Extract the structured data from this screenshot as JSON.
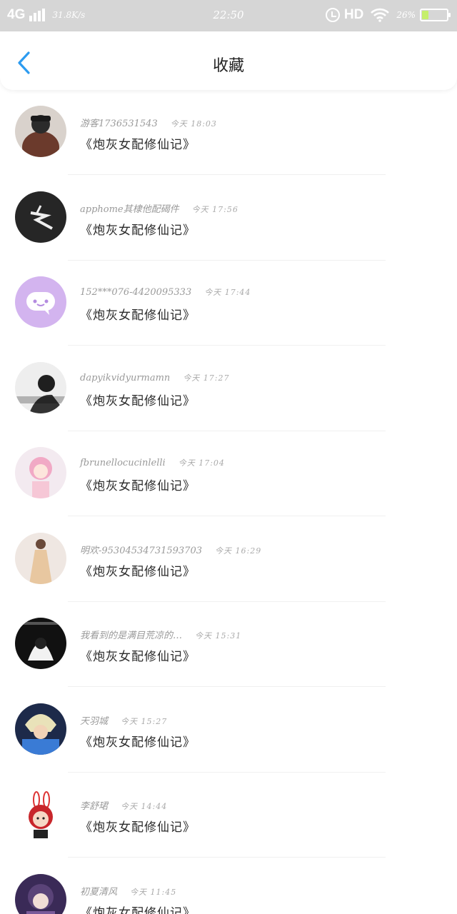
{
  "status_bar": {
    "network": "4G",
    "speed": "31.8K/s",
    "time": "22:50",
    "hd": "HD",
    "battery_pct": "26%",
    "battery_level": 0.26,
    "battery_color": "#c5ef6b"
  },
  "header": {
    "title": "收藏",
    "back_icon": "chevron-left-icon",
    "accent_color": "#2c9bf0"
  },
  "items": [
    {
      "user": "游客1736531543",
      "time": "今天 18:03",
      "title": "《炮灰女配修仙记》"
    },
    {
      "user": "apphome其棣他配碣件",
      "time": "今天 17:56",
      "title": "《炮灰女配修仙记》"
    },
    {
      "user": "152***076-4420095333",
      "time": "今天 17:44",
      "title": "《炮灰女配修仙记》"
    },
    {
      "user": "dapyikvidyurmamn",
      "time": "今天 17:27",
      "title": "《炮灰女配修仙记》"
    },
    {
      "user": "fbrunellocucinlelli",
      "time": "今天 17:04",
      "title": "《炮灰女配修仙记》"
    },
    {
      "user": "明欢-95304534731593703",
      "time": "今天 16:29",
      "title": "《炮灰女配修仙记》"
    },
    {
      "user": "我看到的是满目荒凉的…",
      "time": "今天 15:31",
      "title": "《炮灰女配修仙记》"
    },
    {
      "user": "天羽城",
      "time": "今天 15:27",
      "title": "《炮灰女配修仙记》"
    },
    {
      "user": "李舒珺",
      "time": "今天 14:44",
      "title": "《炮灰女配修仙记》"
    },
    {
      "user": "初夏清风",
      "time": "今天 11:45",
      "title": "《炮灰女配修仙记》"
    }
  ]
}
